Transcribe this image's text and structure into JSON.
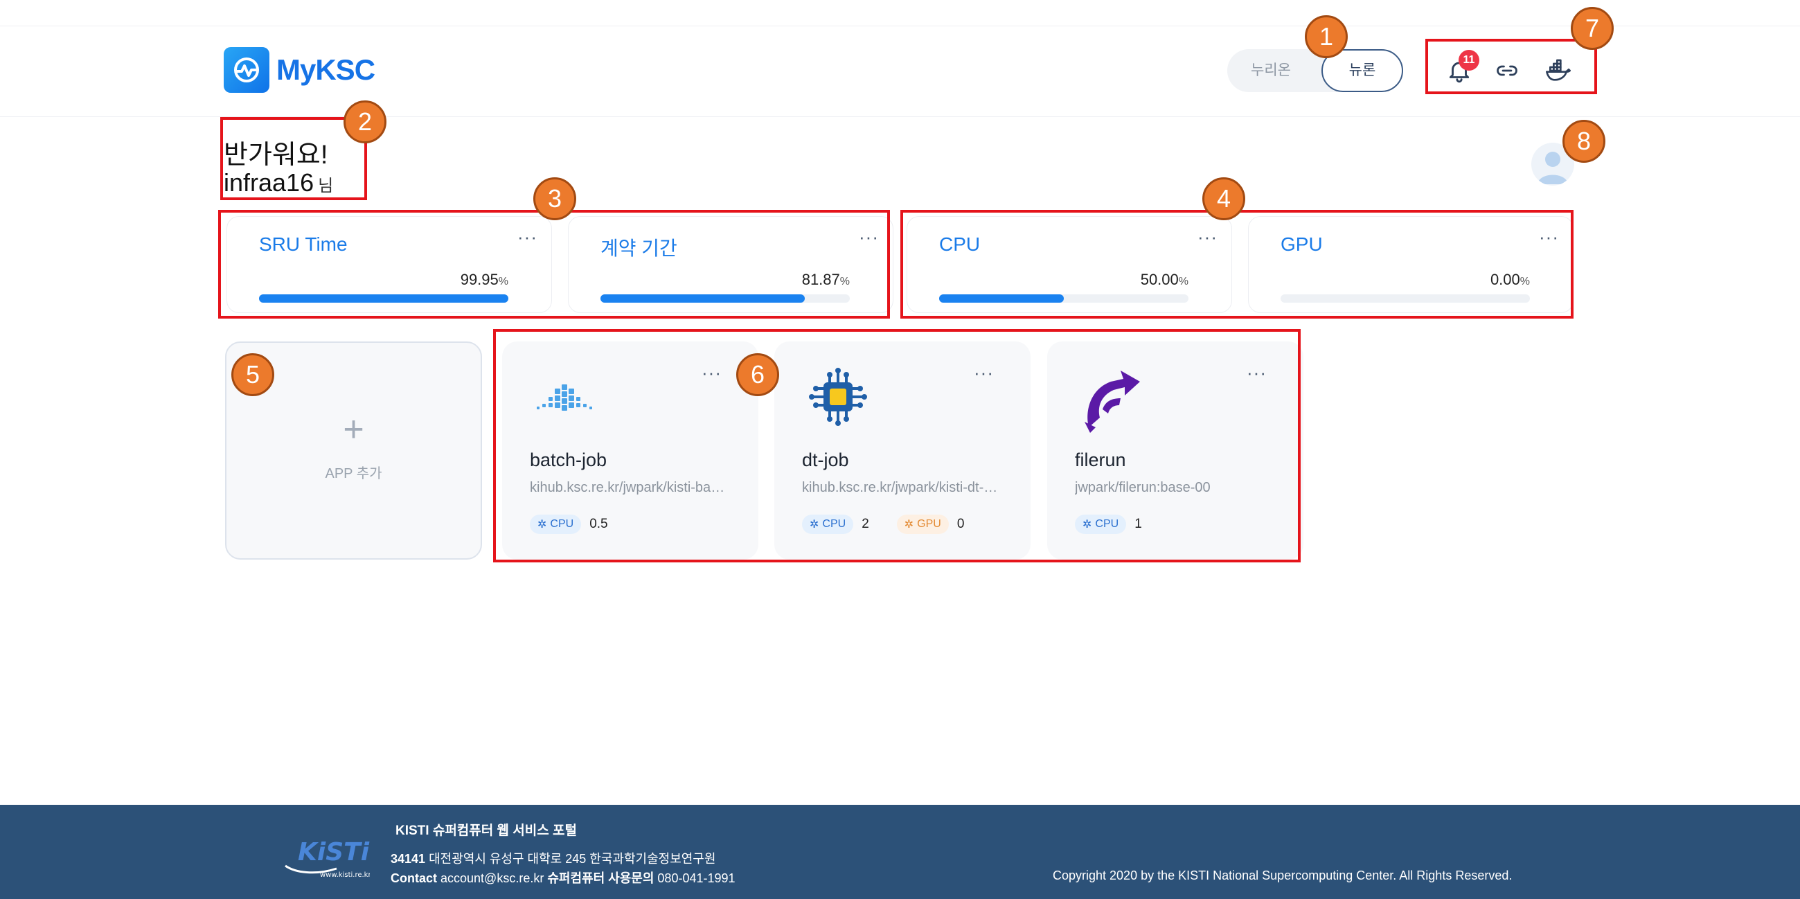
{
  "header": {
    "logo_text": "MyKSC",
    "toggle": {
      "options": [
        "누리온",
        "뉴론"
      ],
      "selected": "뉴론"
    },
    "notifications": {
      "count": "11"
    },
    "icons": [
      "bell-icon",
      "link-icon",
      "docker-icon"
    ]
  },
  "greeting": {
    "line1": "반가워요!",
    "username": "infraa16",
    "suffix": "님"
  },
  "stats": [
    {
      "title": "SRU Time",
      "value": "99.95",
      "unit": "%",
      "percent": 99.95,
      "more": "···"
    },
    {
      "title": "계약 기간",
      "value": "81.87",
      "unit": "%",
      "percent": 81.87,
      "more": "···"
    },
    {
      "title": "CPU",
      "value": "50.00",
      "unit": "%",
      "percent": 50.0,
      "more": "···"
    },
    {
      "title": "GPU",
      "value": "0.00",
      "unit": "%",
      "percent": 0.0,
      "more": "···"
    }
  ],
  "add_app": {
    "plus": "+",
    "label": "APP 추가"
  },
  "apps": [
    {
      "name": "batch-job",
      "image": "kihub.ksc.re.kr/jwpark/kisti-batch-job",
      "more": "···",
      "cpu_label": "CPU",
      "cpu": "0.5",
      "icon": "batch-icon"
    },
    {
      "name": "dt-job",
      "image": "kihub.ksc.re.kr/jwpark/kisti-dt-job",
      "more": "···",
      "cpu_label": "CPU",
      "cpu": "2",
      "gpu_label": "GPU",
      "gpu": "0",
      "icon": "chip-icon"
    },
    {
      "name": "filerun",
      "image": "jwpark/filerun:base-00",
      "more": "···",
      "cpu_label": "CPU",
      "cpu": "1",
      "icon": "filerun-icon"
    }
  ],
  "annotations": [
    "1",
    "2",
    "3",
    "4",
    "5",
    "6",
    "7",
    "8"
  ],
  "footer": {
    "logo_text": "KiSTi",
    "logo_url": "www.kisti.re.kr",
    "title": "KISTI 슈퍼컴퓨터 웹 서비스 포털",
    "zip": "34141",
    "address": "대전광역시 유성구 대학로 245 한국과학기술정보연구원",
    "contact_label": "Contact",
    "contact_email": "account@ksc.re.kr",
    "support_label": "슈퍼컴퓨터 사용문의",
    "support_phone": "080-041-1991",
    "copyright": "Copyright 2020 by the KISTI National Supercomputing Center. All Rights Reserved."
  },
  "colors": {
    "accent": "#1a82f0",
    "annotation_box": "#e5141b",
    "annotation_marker": "#ec7a2c",
    "footer_bg": "#2c5178"
  }
}
